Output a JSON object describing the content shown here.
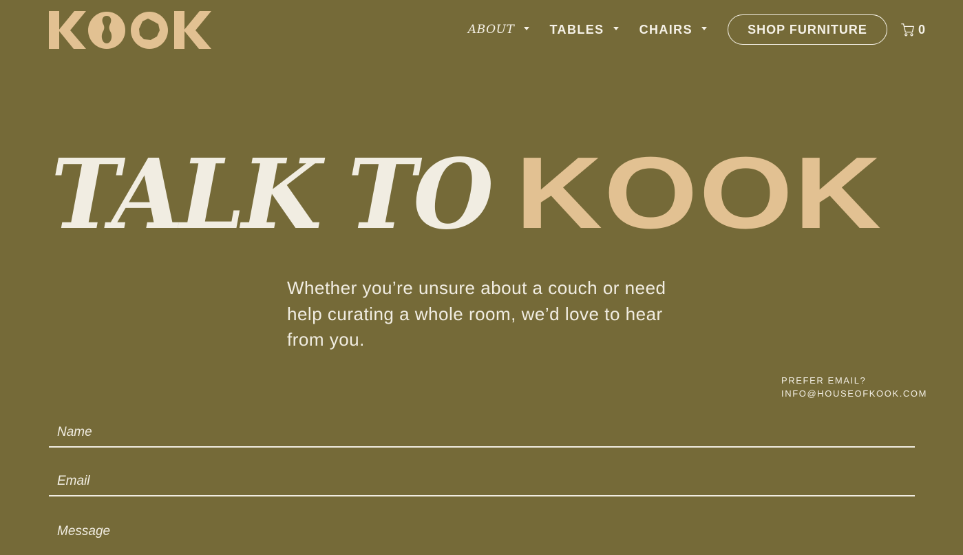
{
  "brand": {
    "logo_text": "KOOK",
    "logo_color": "#e2c192"
  },
  "nav": {
    "items": [
      {
        "label": "ABOUT",
        "has_dropdown": true,
        "icon": "caret-down-icon"
      },
      {
        "label": "TABLES",
        "has_dropdown": true,
        "icon": "caret-down-icon"
      },
      {
        "label": "CHAIRS",
        "has_dropdown": true,
        "icon": "caret-down-icon"
      }
    ],
    "shop_button_label": "SHOP FURNITURE",
    "cart": {
      "icon": "cart-icon",
      "count": "0"
    }
  },
  "hero": {
    "title_part1": "TALK TO",
    "title_part2": "KOOK",
    "intro": "Whether you’re unsure about a couch or need help curating a whole room, we’d love to hear from you."
  },
  "contact": {
    "prompt": "PREFER EMAIL?",
    "email": "INFO@HOUSEOFKOOK.COM"
  },
  "form": {
    "name_placeholder": "Name",
    "email_placeholder": "Email",
    "message_placeholder": "Message"
  },
  "colors": {
    "background": "#756a38",
    "cream": "#f1ede2",
    "accent": "#e2c192"
  }
}
